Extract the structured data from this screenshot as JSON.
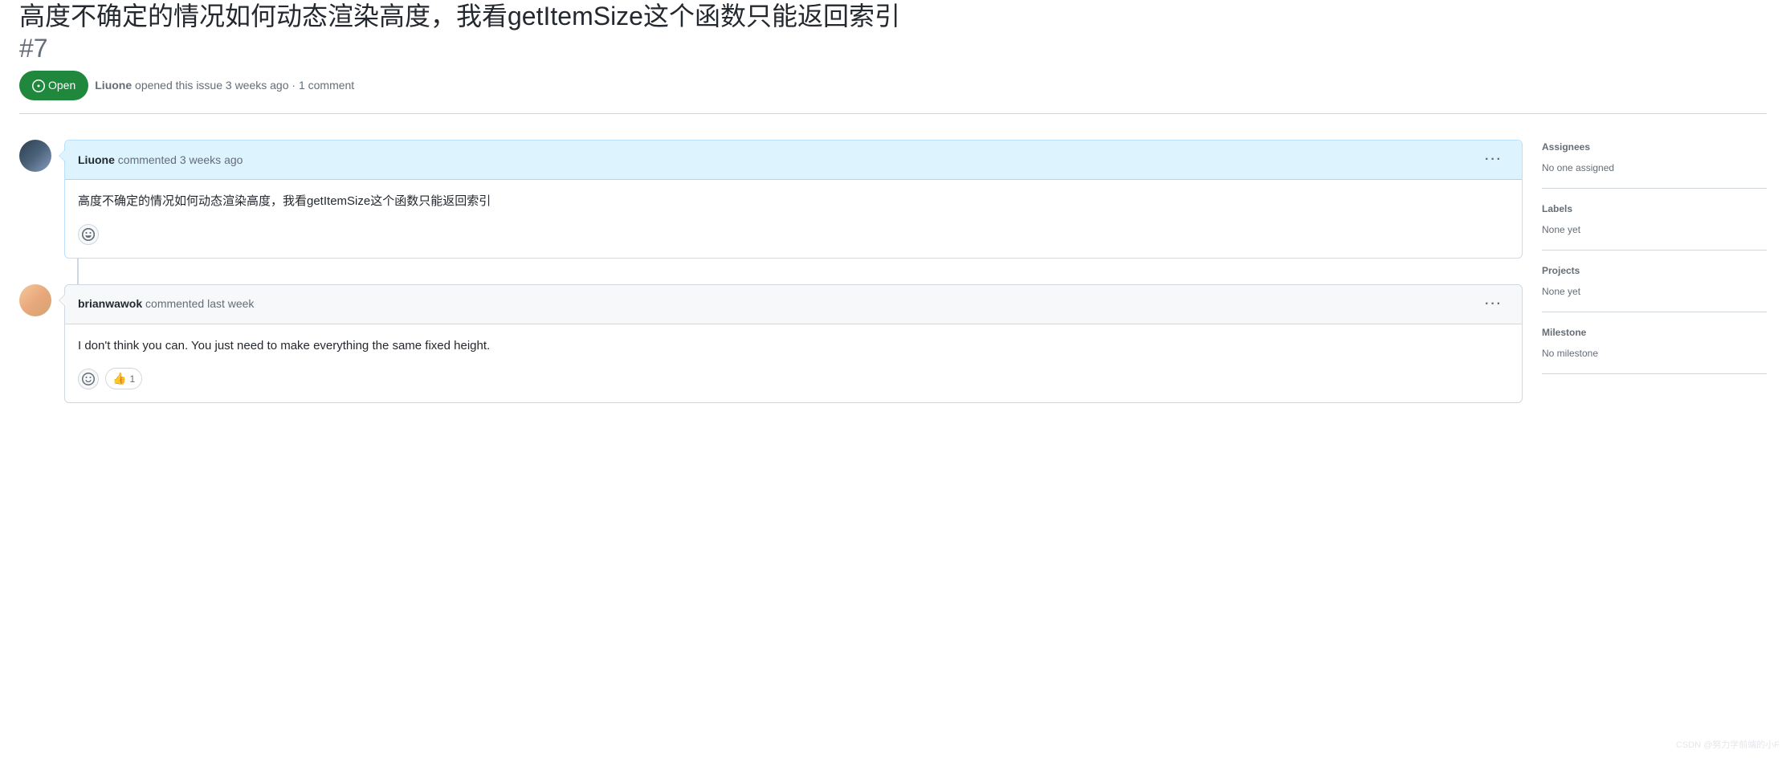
{
  "issue": {
    "title": "高度不确定的情况如何动态渲染高度，我看getItemSize这个函数只能返回索引",
    "number": "#7",
    "status": "Open",
    "meta_author": "Liuone",
    "meta_action": "opened this issue",
    "meta_time": "3 weeks ago",
    "meta_separator": " · ",
    "meta_comments": "1 comment"
  },
  "comments": [
    {
      "author": "Liuone",
      "action": "commented",
      "time": "3 weeks ago",
      "body": "高度不确定的情况如何动态渲染高度，我看getItemSize这个函数只能返回索引",
      "is_author": true,
      "reactions": []
    },
    {
      "author": "brianwawok",
      "action": "commented",
      "time": "last week",
      "body": "I don't think you can. You just need to make everything the same fixed height.",
      "is_author": false,
      "reactions": [
        {
          "emoji": "👍",
          "count": "1"
        }
      ]
    }
  ],
  "sidebar": {
    "assignees": {
      "title": "Assignees",
      "value": "No one assigned"
    },
    "labels": {
      "title": "Labels",
      "value": "None yet"
    },
    "projects": {
      "title": "Projects",
      "value": "None yet"
    },
    "milestone": {
      "title": "Milestone",
      "value": "No milestone"
    }
  },
  "watermark": "CSDN @努力学前端的小F"
}
